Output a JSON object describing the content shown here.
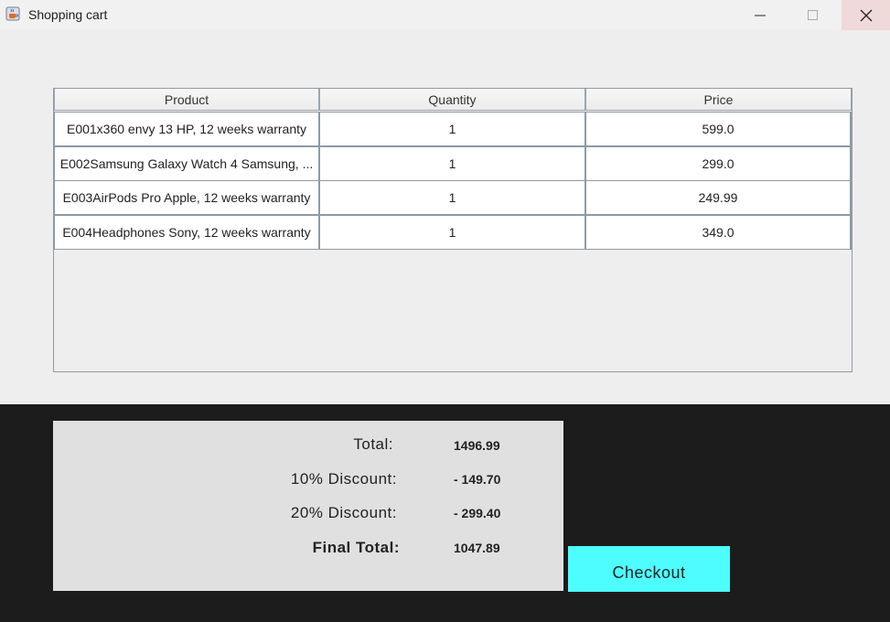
{
  "window": {
    "title": "Shopping cart",
    "app_icon": "java-cup-icon"
  },
  "table": {
    "headers": [
      "Product",
      "Quantity",
      "Price"
    ],
    "rows": [
      [
        "E001x360 envy 13 HP, 12 weeks warranty",
        "1",
        "599.0"
      ],
      [
        "E002Samsung Galaxy Watch 4 Samsung, ...",
        "1",
        "299.0"
      ],
      [
        "E003AirPods Pro Apple, 12 weeks warranty",
        "1",
        "249.99"
      ],
      [
        "E004Headphones Sony, 12 weeks warranty",
        "1",
        "349.0"
      ]
    ]
  },
  "summary": {
    "total_label": "Total:",
    "total_value": "1496.99",
    "discount10_label": "10% Discount:",
    "discount10_value": "- 149.70",
    "discount20_label": "20% Discount:",
    "discount20_value": "- 299.40",
    "final_label": "Final Total:",
    "final_value": "1047.89"
  },
  "checkout_label": "Checkout",
  "colors": {
    "checkout_bg": "#4dfdff",
    "bottom_bg": "#1c1c1c",
    "summary_bg": "#e0e0e0"
  }
}
